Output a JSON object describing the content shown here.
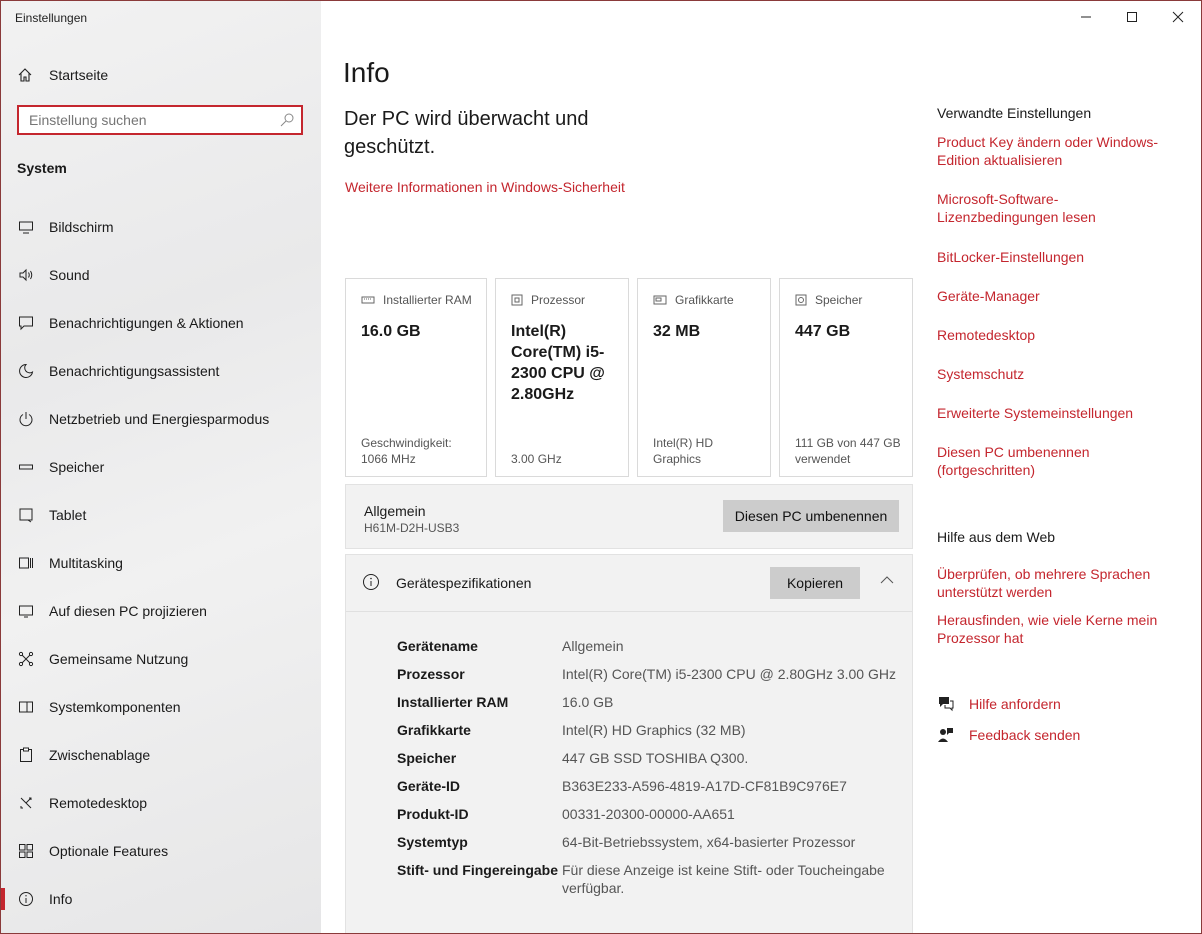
{
  "window": {
    "title": "Einstellungen"
  },
  "sidebar": {
    "home_label": "Startseite",
    "search_placeholder": "Einstellung suchen",
    "section": "System",
    "items": [
      {
        "label": "Bildschirm",
        "icon": "monitor-icon"
      },
      {
        "label": "Sound",
        "icon": "speaker-icon"
      },
      {
        "label": "Benachrichtigungen & Aktionen",
        "icon": "notification-icon"
      },
      {
        "label": "Benachrichtigungsassistent",
        "icon": "moon-icon"
      },
      {
        "label": "Netzbetrieb und Energiesparmodus",
        "icon": "power-icon"
      },
      {
        "label": "Speicher",
        "icon": "storage-icon"
      },
      {
        "label": "Tablet",
        "icon": "tablet-icon"
      },
      {
        "label": "Multitasking",
        "icon": "multitasking-icon"
      },
      {
        "label": "Auf diesen PC projizieren",
        "icon": "project-icon"
      },
      {
        "label": "Gemeinsame Nutzung",
        "icon": "share-icon"
      },
      {
        "label": "Systemkomponenten",
        "icon": "components-icon"
      },
      {
        "label": "Zwischenablage",
        "icon": "clipboard-icon"
      },
      {
        "label": "Remotedesktop",
        "icon": "remote-icon"
      },
      {
        "label": "Optionale Features",
        "icon": "features-icon"
      },
      {
        "label": "Info",
        "icon": "info-icon",
        "active": true
      }
    ]
  },
  "main": {
    "title": "Info",
    "status": "Der PC wird überwacht und geschützt.",
    "security_link": "Weitere Informationen in Windows-Sicherheit",
    "cards": [
      {
        "label": "Installierter RAM",
        "value": "16.0 GB",
        "sub": "Geschwindigkeit: 1066 MHz",
        "icon": "ram-icon"
      },
      {
        "label": "Prozessor",
        "value": "Intel(R) Core(TM) i5-2300 CPU @ 2.80GHz",
        "sub": "3.00 GHz",
        "icon": "cpu-icon"
      },
      {
        "label": "Grafikkarte",
        "value": "32 MB",
        "sub": "Intel(R) HD Graphics",
        "icon": "gpu-icon"
      },
      {
        "label": "Speicher",
        "value": "447 GB",
        "sub": "111 GB von 447 GB verwendet",
        "icon": "disk-icon"
      }
    ],
    "device": {
      "name": "Allgemein",
      "model": "H61M-D2H-USB3",
      "rename_button": "Diesen PC umbenennen"
    },
    "specs": {
      "title": "Gerätespezifikationen",
      "copy_button": "Kopieren",
      "rows": [
        {
          "key": "Gerätename",
          "value": "Allgemein"
        },
        {
          "key": "Prozessor",
          "value": "Intel(R) Core(TM) i5-2300 CPU @ 2.80GHz   3.00 GHz"
        },
        {
          "key": "Installierter RAM",
          "value": "16.0 GB"
        },
        {
          "key": "Grafikkarte",
          "value": "Intel(R) HD Graphics (32 MB)"
        },
        {
          "key": "Speicher",
          "value": "447 GB SSD TOSHIBA Q300."
        },
        {
          "key": "Geräte-ID",
          "value": "B363E233-A596-4819-A17D-CF81B9C976E7"
        },
        {
          "key": "Produkt-ID",
          "value": "00331-20300-00000-AA651"
        },
        {
          "key": "Systemtyp",
          "value": "64-Bit-Betriebssystem, x64-basierter Prozessor"
        },
        {
          "key": "Stift- und Fingereingabe",
          "value": "Für diese Anzeige ist keine Stift- oder Toucheingabe verfügbar."
        }
      ]
    }
  },
  "related": {
    "heading": "Verwandte Einstellungen",
    "links": [
      "Product Key ändern oder Windows-Edition aktualisieren",
      "Microsoft-Software-Lizenzbedingungen lesen",
      "BitLocker-Einstellungen",
      "Geräte-Manager",
      "Remotedesktop",
      "Systemschutz",
      "Erweiterte Systemeinstellungen",
      "Diesen PC umbenennen (fortgeschritten)"
    ]
  },
  "web_help": {
    "heading": "Hilfe aus dem Web",
    "links": [
      "Überprüfen, ob mehrere Sprachen unterstützt werden",
      "Herausfinden, wie viele Kerne mein Prozessor hat"
    ]
  },
  "help": {
    "get_help": "Hilfe anfordern",
    "feedback": "Feedback senden"
  },
  "colors": {
    "accent": "#c4262e",
    "sidebar_bg": "#ececed",
    "panel_bg": "#f2f2f2"
  }
}
